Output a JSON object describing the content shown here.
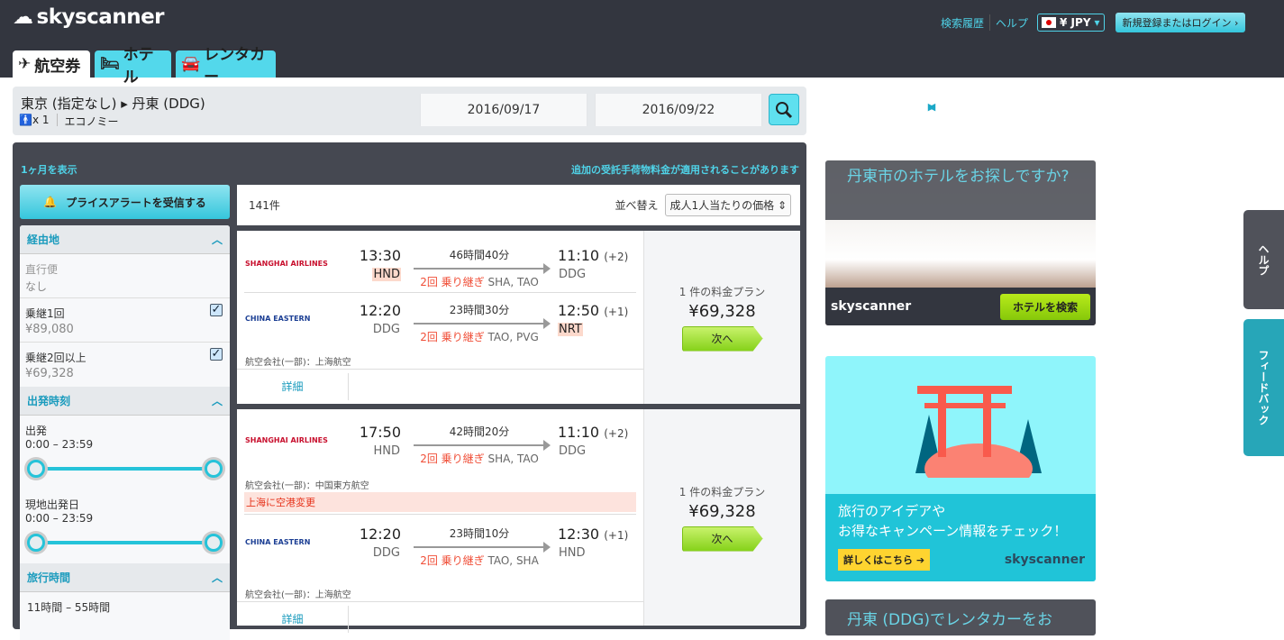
{
  "header": {
    "logo": "skyscanner",
    "tabs": [
      {
        "label": "航空券",
        "icon": "plane-icon"
      },
      {
        "label": "ホテル",
        "icon": "bed-icon"
      },
      {
        "label": "レンタカー",
        "icon": "car-icon"
      }
    ],
    "links": {
      "history": "検索履歴",
      "help": "ヘルプ",
      "currency": "¥ JPY",
      "login": "新規登録またはログイン ›"
    }
  },
  "search": {
    "route": "東京 (指定なし) ▸ 丹東 (DDG)",
    "passengers": "x 1",
    "cabin": "エコノミー",
    "depart_date": "2016/09/17",
    "return_date": "2016/09/22"
  },
  "panel": {
    "month_link": "1ヶ月を表示",
    "bag_note": "追加の受託手荷物料金が適用されることがあります"
  },
  "sidebar": {
    "alert_button": "プライスアラートを受信する",
    "stops": {
      "title": "経由地",
      "items": [
        {
          "label": "直行便",
          "value": "なし",
          "checked": null
        },
        {
          "label": "乗継1回",
          "value": "¥89,080",
          "checked": true
        },
        {
          "label": "乗継2回以上",
          "value": "¥69,328",
          "checked": true
        }
      ]
    },
    "times": {
      "title": "出発時刻",
      "sliders": [
        {
          "label": "出発",
          "range": "0:00 – 23:59"
        },
        {
          "label": "現地出発日",
          "range": "0:00 – 23:59"
        }
      ]
    },
    "duration": {
      "title": "旅行時間",
      "range": "11時間 – 55時間"
    }
  },
  "results": {
    "count": "141件",
    "sort_label": "並べ替え",
    "sort_value": "成人1人当たりの価格",
    "cards": [
      {
        "legs": [
          {
            "airline": "上海航空",
            "logo_text": "SHANGHAI AIRLINES",
            "dep_time": "13:30",
            "dep_ap": "HND",
            "duration": "46時間40分",
            "stops": "2回 乗り継ぎ",
            "codes": "SHA, TAO",
            "arr_time": "11:10",
            "plus": "(+2)",
            "arr_ap": "DDG"
          },
          {
            "airline": "中国東方航空",
            "logo_text": "CHINA EASTERN",
            "dep_time": "12:20",
            "dep_ap": "DDG",
            "duration": "23時間30分",
            "stops": "2回 乗り継ぎ",
            "codes": "TAO, PVG",
            "arr_time": "12:50",
            "plus": "(+1)",
            "arr_ap": "NRT"
          }
        ],
        "operator": "航空会社(一部)：上海航空",
        "detail": "詳細",
        "plans": "1 件の料金プラン",
        "price": "¥69,328",
        "next": "次へ"
      },
      {
        "legs": [
          {
            "logo_text": "SHANGHAI AIRLINES",
            "dep_time": "17:50",
            "dep_ap": "HND",
            "duration": "42時間20分",
            "stops": "2回 乗り継ぎ",
            "codes": "SHA, TAO",
            "arr_time": "11:10",
            "plus": "(+2)",
            "arr_ap": "DDG"
          },
          {
            "logo_text": "CHINA EASTERN",
            "dep_time": "12:20",
            "dep_ap": "DDG",
            "duration": "23時間10分",
            "stops": "2回 乗り継ぎ",
            "codes": "TAO, SHA",
            "arr_time": "12:30",
            "plus": "(+1)",
            "arr_ap": "HND"
          }
        ],
        "operator1": "航空会社(一部)：中国東方航空",
        "warning": "上海に空港変更",
        "operator2": "航空会社(一部)：上海航空",
        "detail": "詳細",
        "plans": "1 件の料金プラン",
        "price": "¥69,328",
        "next": "次へ"
      }
    ]
  },
  "ads": {
    "hotel": {
      "title": "丹東市のホテルをお探しですか?",
      "brand": "skyscanner",
      "button": "ホテルを検索"
    },
    "campaign": {
      "line1": "旅行のアイデアや",
      "line2": "お得なキャンペーン情報をチェック！",
      "button": "詳しくはこちら ➔",
      "brand": "skyscanner"
    },
    "car": {
      "title": "丹東 (DDG)でレンタカーをお"
    }
  },
  "side_tabs": {
    "help": "ヘルプ",
    "feedback": "フィードバック"
  }
}
